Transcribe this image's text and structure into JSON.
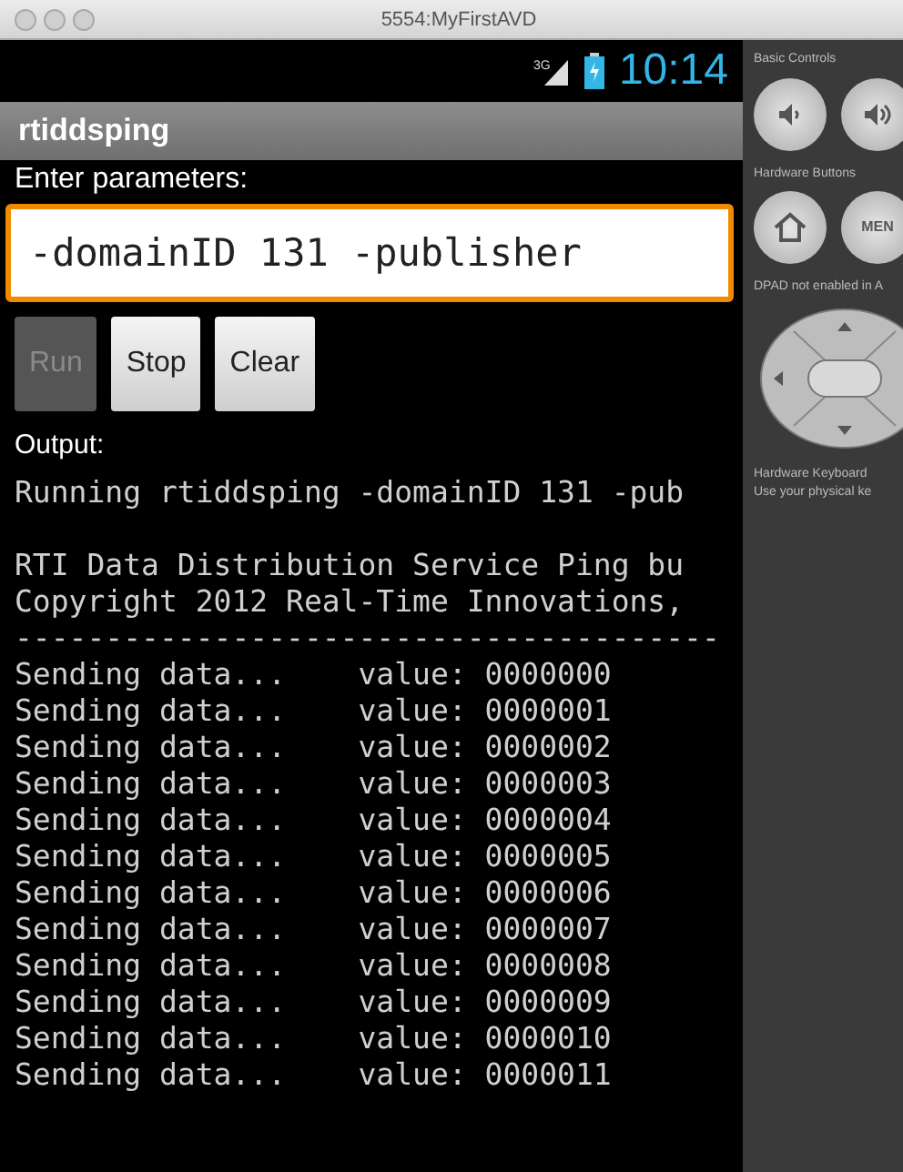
{
  "window": {
    "title": "5554:MyFirstAVD"
  },
  "status_bar": {
    "network": "3G",
    "time": "10:14"
  },
  "app": {
    "title": "rtiddsping",
    "prompt": "Enter parameters:",
    "parameters": {
      "value": "-domainID 131 -publisher",
      "focused": true
    },
    "buttons": [
      {
        "label": "Run",
        "disabled": true
      },
      {
        "label": "Stop",
        "disabled": false
      },
      {
        "label": "Clear",
        "disabled": false
      }
    ],
    "output_label": "Output:",
    "output_lines": [
      {
        "text": "Running rtiddsping -domainID 131 -pub",
        "gap_before": false
      },
      {
        "text": "RTI Data Distribution Service Ping bu",
        "gap_before": true
      },
      {
        "text": "Copyright 2012 Real-Time Innovations,",
        "gap_before": false
      },
      {
        "text": "---------------------------------------",
        "gap_before": false
      },
      {
        "text": "Sending data...    value: 0000000",
        "gap_before": false
      },
      {
        "text": "Sending data...    value: 0000001",
        "gap_before": false
      },
      {
        "text": "Sending data...    value: 0000002",
        "gap_before": false
      },
      {
        "text": "Sending data...    value: 0000003",
        "gap_before": false
      },
      {
        "text": "Sending data...    value: 0000004",
        "gap_before": false
      },
      {
        "text": "Sending data...    value: 0000005",
        "gap_before": false
      },
      {
        "text": "Sending data...    value: 0000006",
        "gap_before": false
      },
      {
        "text": "Sending data...    value: 0000007",
        "gap_before": false
      },
      {
        "text": "Sending data...    value: 0000008",
        "gap_before": false
      },
      {
        "text": "Sending data...    value: 0000009",
        "gap_before": false
      },
      {
        "text": "Sending data...    value: 0000010",
        "gap_before": false
      },
      {
        "text": "Sending data...    value: 0000011",
        "gap_before": false
      }
    ]
  },
  "controls_panel": {
    "basic_controls": "Basic Controls",
    "hardware_buttons": "Hardware Buttons",
    "menu_button": "MEN",
    "dpad_note": "DPAD not enabled in A",
    "keyboard_title": "Hardware Keyboard",
    "keyboard_note": "Use your physical ke"
  }
}
